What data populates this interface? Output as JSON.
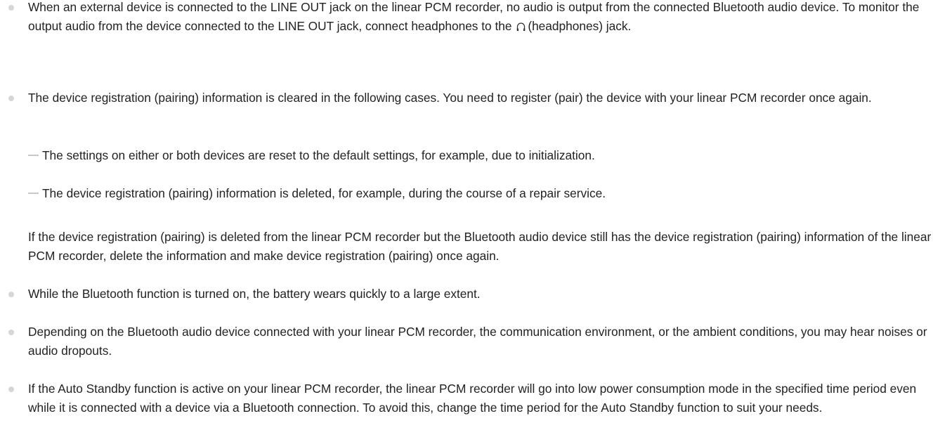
{
  "notes": {
    "n1": {
      "text_a": "When an external device is connected to the LINE OUT jack on the linear PCM recorder, no audio is output from the connected Bluetooth audio device. To monitor the output audio from the device connected to the LINE OUT jack, connect headphones to the",
      "text_b": "(headphones) jack."
    },
    "n2": {
      "text": "The device registration (pairing) information is cleared in the following cases. You need to register (pair) the device with your linear PCM recorder once again.",
      "sub_items": [
        "The settings on either or both devices are reset to the default settings, for example, due to initialization.",
        "The device registration (pairing) information is deleted, for example, during the course of a repair service."
      ],
      "follow_up": "If the device registration (pairing) is deleted from the linear PCM recorder but the Bluetooth audio device still has the device registration (pairing) information of the linear PCM recorder, delete the information and make device registration (pairing) once again."
    },
    "n3": {
      "text": "While the Bluetooth function is turned on, the battery wears quickly to a large extent."
    },
    "n4": {
      "text": "Depending on the Bluetooth audio device connected with your linear PCM recorder, the communication environment, or the ambient conditions, you may hear noises or audio dropouts."
    },
    "n5": {
      "text": "If the Auto Standby function is active on your linear PCM recorder, the linear PCM recorder will go into low power consumption mode in the specified time period even while it is connected with a device via a Bluetooth connection. To avoid this, change the time period for the Auto Standby function to suit your needs."
    }
  }
}
